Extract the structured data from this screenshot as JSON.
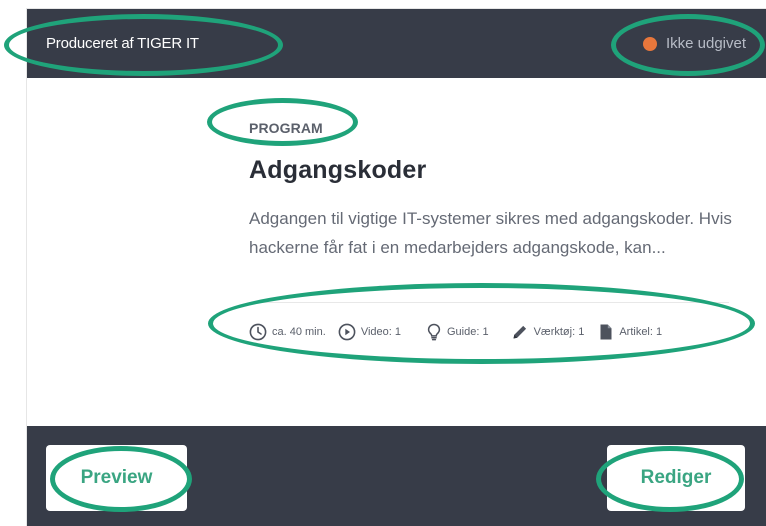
{
  "card": {
    "producer": "Produceret af TIGER IT",
    "status": "Ikke udgivet",
    "kicker": "PROGRAM",
    "title": "Adgangskoder",
    "description": "Adgangen til vigtige IT-systemer sikres med adgangskoder. Hvis hackerne får fat i en medarbejders adgangskode, kan..."
  },
  "meta": {
    "duration": "ca. 40 min.",
    "video": "Video: 1",
    "guide": "Guide: 1",
    "tool": "Værktøj: 1",
    "article": "Artikel: 1"
  },
  "actions": {
    "preview": "Preview",
    "edit": "Rediger"
  },
  "icons": {
    "duration": "clock-icon",
    "video": "play-circle-icon",
    "guide": "lightbulb-icon",
    "tool": "pencil-icon",
    "article": "document-icon"
  },
  "colors": {
    "dark_bar": "#373c48",
    "status_dot": "#e8773c",
    "button_text": "#3aa582",
    "annotation": "#1fa37a"
  }
}
